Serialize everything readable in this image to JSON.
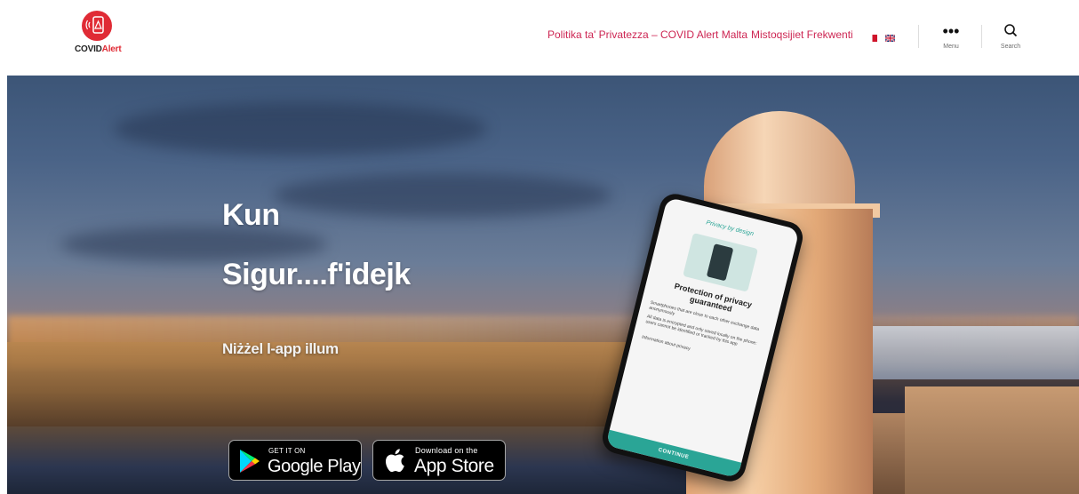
{
  "header": {
    "logo": {
      "text_main": "COVID",
      "text_accent": "Alert",
      "brand_color": "#e02b35"
    },
    "nav": {
      "privacy": "Politika ta' Privatezza – COVID Alert Malta",
      "faq": "Mistoqsijiet Frekwenti"
    },
    "flags": [
      "flag-malta-icon",
      "flag-uk-icon"
    ],
    "menu_label": "Menu",
    "search_label": "Search",
    "accent_color": "#cd2653"
  },
  "hero": {
    "title_line1": "Kun",
    "title_line2": "Sigur....f'idejk",
    "subtitle": "Niżżel l-app illum",
    "google_play": {
      "small": "GET IT ON",
      "big": "Google Play"
    },
    "app_store": {
      "small": "Download on the",
      "big": "App Store"
    },
    "phone_screen": {
      "title": "Privacy by design",
      "heading": "Protection of privacy guaranteed",
      "lines": [
        "Smartphones that are close to each other exchange data anonymously",
        "All data is encrypted and only saved locally on the phone: users cannot be identified or tracked by this app",
        "Information about privacy"
      ],
      "button": "CONTINUE",
      "theme_color": "#2aa596"
    }
  }
}
